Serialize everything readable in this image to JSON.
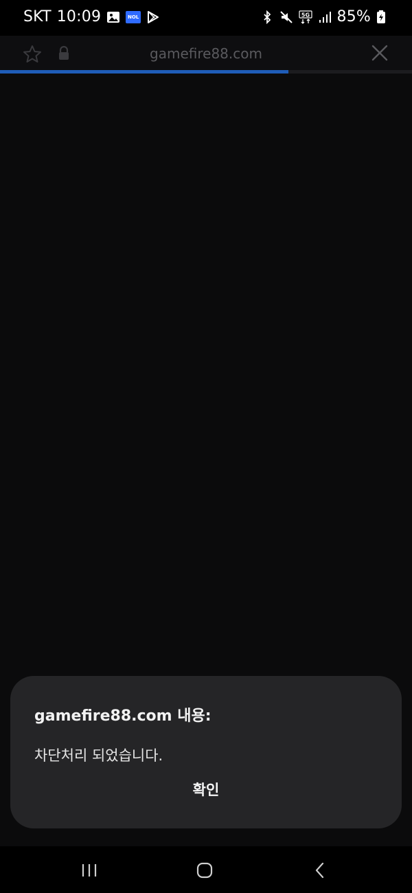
{
  "status_bar": {
    "carrier": "SKT",
    "time": "10:09",
    "notification_icons": [
      "gallery-icon",
      "nol-app-icon",
      "play-store-icon"
    ],
    "nol_label": "NOL",
    "system_icons": [
      "bluetooth-icon",
      "mute-icon",
      "5g-icon",
      "signal-icon",
      "battery-icon"
    ],
    "battery": "85%"
  },
  "toolbar": {
    "url": "gamefire88.com",
    "left_icons": [
      "star-icon",
      "lock-icon"
    ],
    "right_icon": "close-icon",
    "load_progress": 0.7
  },
  "dialog": {
    "title": "gamefire88.com 내용:",
    "message": "차단처리 되었습니다.",
    "confirm_label": "확인"
  },
  "nav_bar": {
    "buttons": [
      "recents-button",
      "home-button",
      "back-button"
    ]
  },
  "colors": {
    "background": "#0b0b0c",
    "dialog_bg": "#252527",
    "progress": "#1f5db8",
    "url_text": "#5a5a5e"
  }
}
